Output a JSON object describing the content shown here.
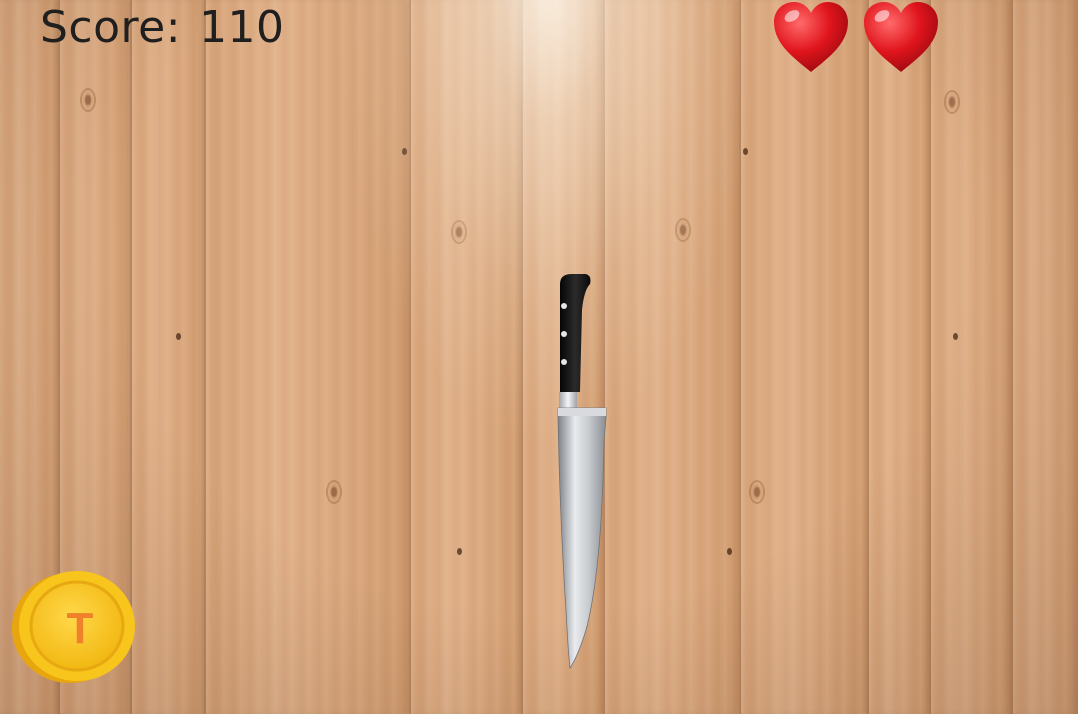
{
  "hud": {
    "score_label": "Score:",
    "score_value": "110",
    "lives": 2
  },
  "colors": {
    "heart": "#e0141c",
    "coin": "#f4c21a",
    "coin_letter": "#f0812a",
    "wood": "#d9a57a"
  },
  "coin_button": {
    "letter": "T",
    "icon": "coin-icon"
  },
  "knife": {
    "icon": "chef-knife-icon"
  }
}
